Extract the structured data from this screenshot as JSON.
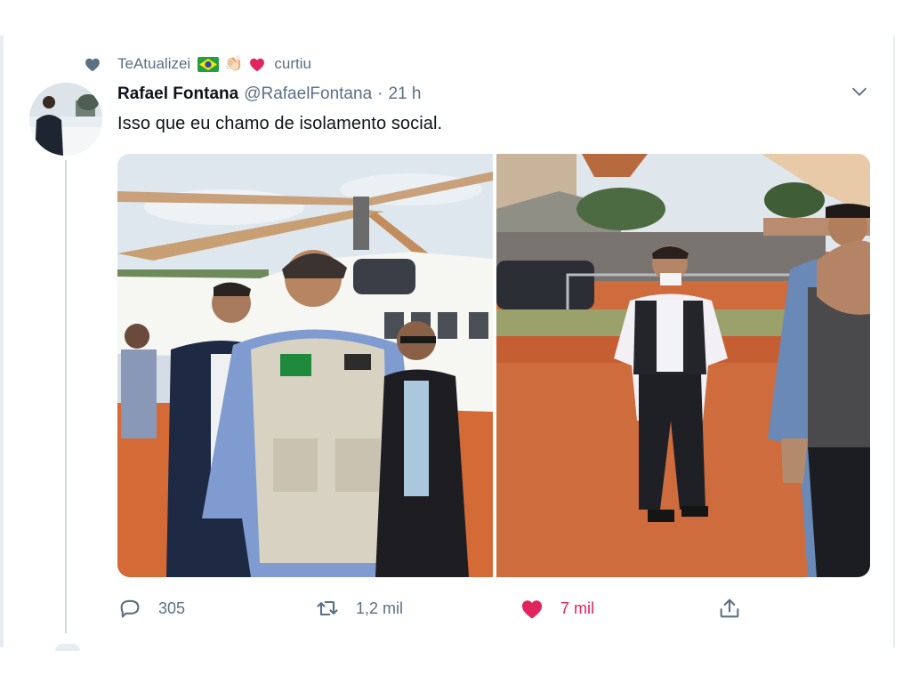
{
  "social_context": {
    "user": "TeAtualizei",
    "emoji": [
      "brazil-flag",
      "raised-hands",
      "red-heart"
    ],
    "action": "curtiu"
  },
  "tweet": {
    "author_name": "Rafael Fontana",
    "author_handle": "@RafaelFontana",
    "separator": "·",
    "time": "21 h",
    "text": "Isso que eu chamo de isolamento social.",
    "media": [
      {
        "type": "photo",
        "subject": "man in vest walking near helicopter with others"
      },
      {
        "type": "photo",
        "subject": "masked man standing alone on red dirt field"
      }
    ]
  },
  "actions": {
    "reply_count": "305",
    "retweet_count": "1,2 mil",
    "like_count": "7 mil",
    "liked": true
  },
  "colors": {
    "secondary_text": "#5b7083",
    "like": "#e0245e",
    "primary_text": "#0f1419",
    "thread_line": "#cfd9de"
  }
}
